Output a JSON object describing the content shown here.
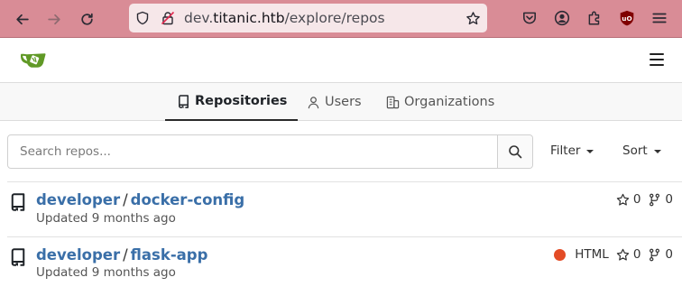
{
  "browser": {
    "url_prefix": "dev.",
    "url_host": "titanic.htb",
    "url_path": "/explore/repos"
  },
  "tabs": [
    {
      "label": "Repositories",
      "icon": "repo-icon",
      "active": true
    },
    {
      "label": "Users",
      "icon": "person-icon",
      "active": false
    },
    {
      "label": "Organizations",
      "icon": "organization-icon",
      "active": false
    }
  ],
  "search": {
    "placeholder": "Search repos...",
    "value": ""
  },
  "controls": {
    "filter_label": "Filter",
    "sort_label": "Sort"
  },
  "repos": [
    {
      "owner": "developer",
      "separator": "/",
      "name": "docker-config",
      "updated": "Updated 9 months ago",
      "language": "",
      "stars": "0",
      "forks": "0"
    },
    {
      "owner": "developer",
      "separator": "/",
      "name": "flask-app",
      "updated": "Updated 9 months ago",
      "language": "HTML",
      "language_color": "#e34c26",
      "stars": "0",
      "forks": "0"
    }
  ],
  "colors": {
    "browser_bar": "#d98c96",
    "link": "#3a6fa8",
    "logo_green": "#609926"
  }
}
